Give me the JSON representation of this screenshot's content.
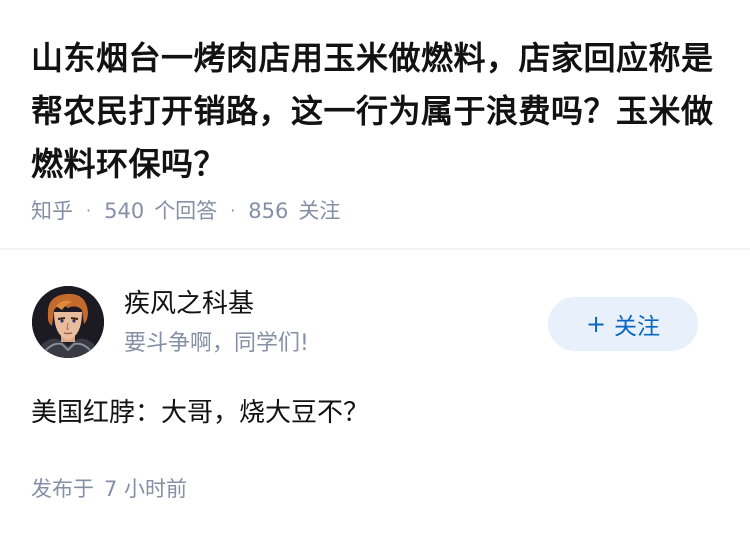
{
  "question": {
    "title": "山东烟台一烤肉店用玉米做燃料，店家回应称是帮农民打开销路，这一行为属于浪费吗？玉米做燃料环保吗？",
    "source": "知乎",
    "answer_count": "540",
    "answer_label": "个回答",
    "follower_count": "856",
    "follower_label": "关注"
  },
  "author": {
    "name": "疾风之科基",
    "bio": "要斗争啊，同学们!",
    "avatar_icon": "anime-character-avatar",
    "follow_button": {
      "icon": "plus-icon",
      "plus": "+",
      "label": "关注"
    }
  },
  "answer": {
    "text": "美国红脖：大哥，烧大豆不？",
    "time_label": "发布于",
    "time_value": "7 小时前"
  },
  "colors": {
    "text_primary": "#121212",
    "text_secondary": "#8590a6",
    "accent": "#0a66c2",
    "button_bg": "#e8f1fb",
    "divider": "#f0f2f5"
  }
}
